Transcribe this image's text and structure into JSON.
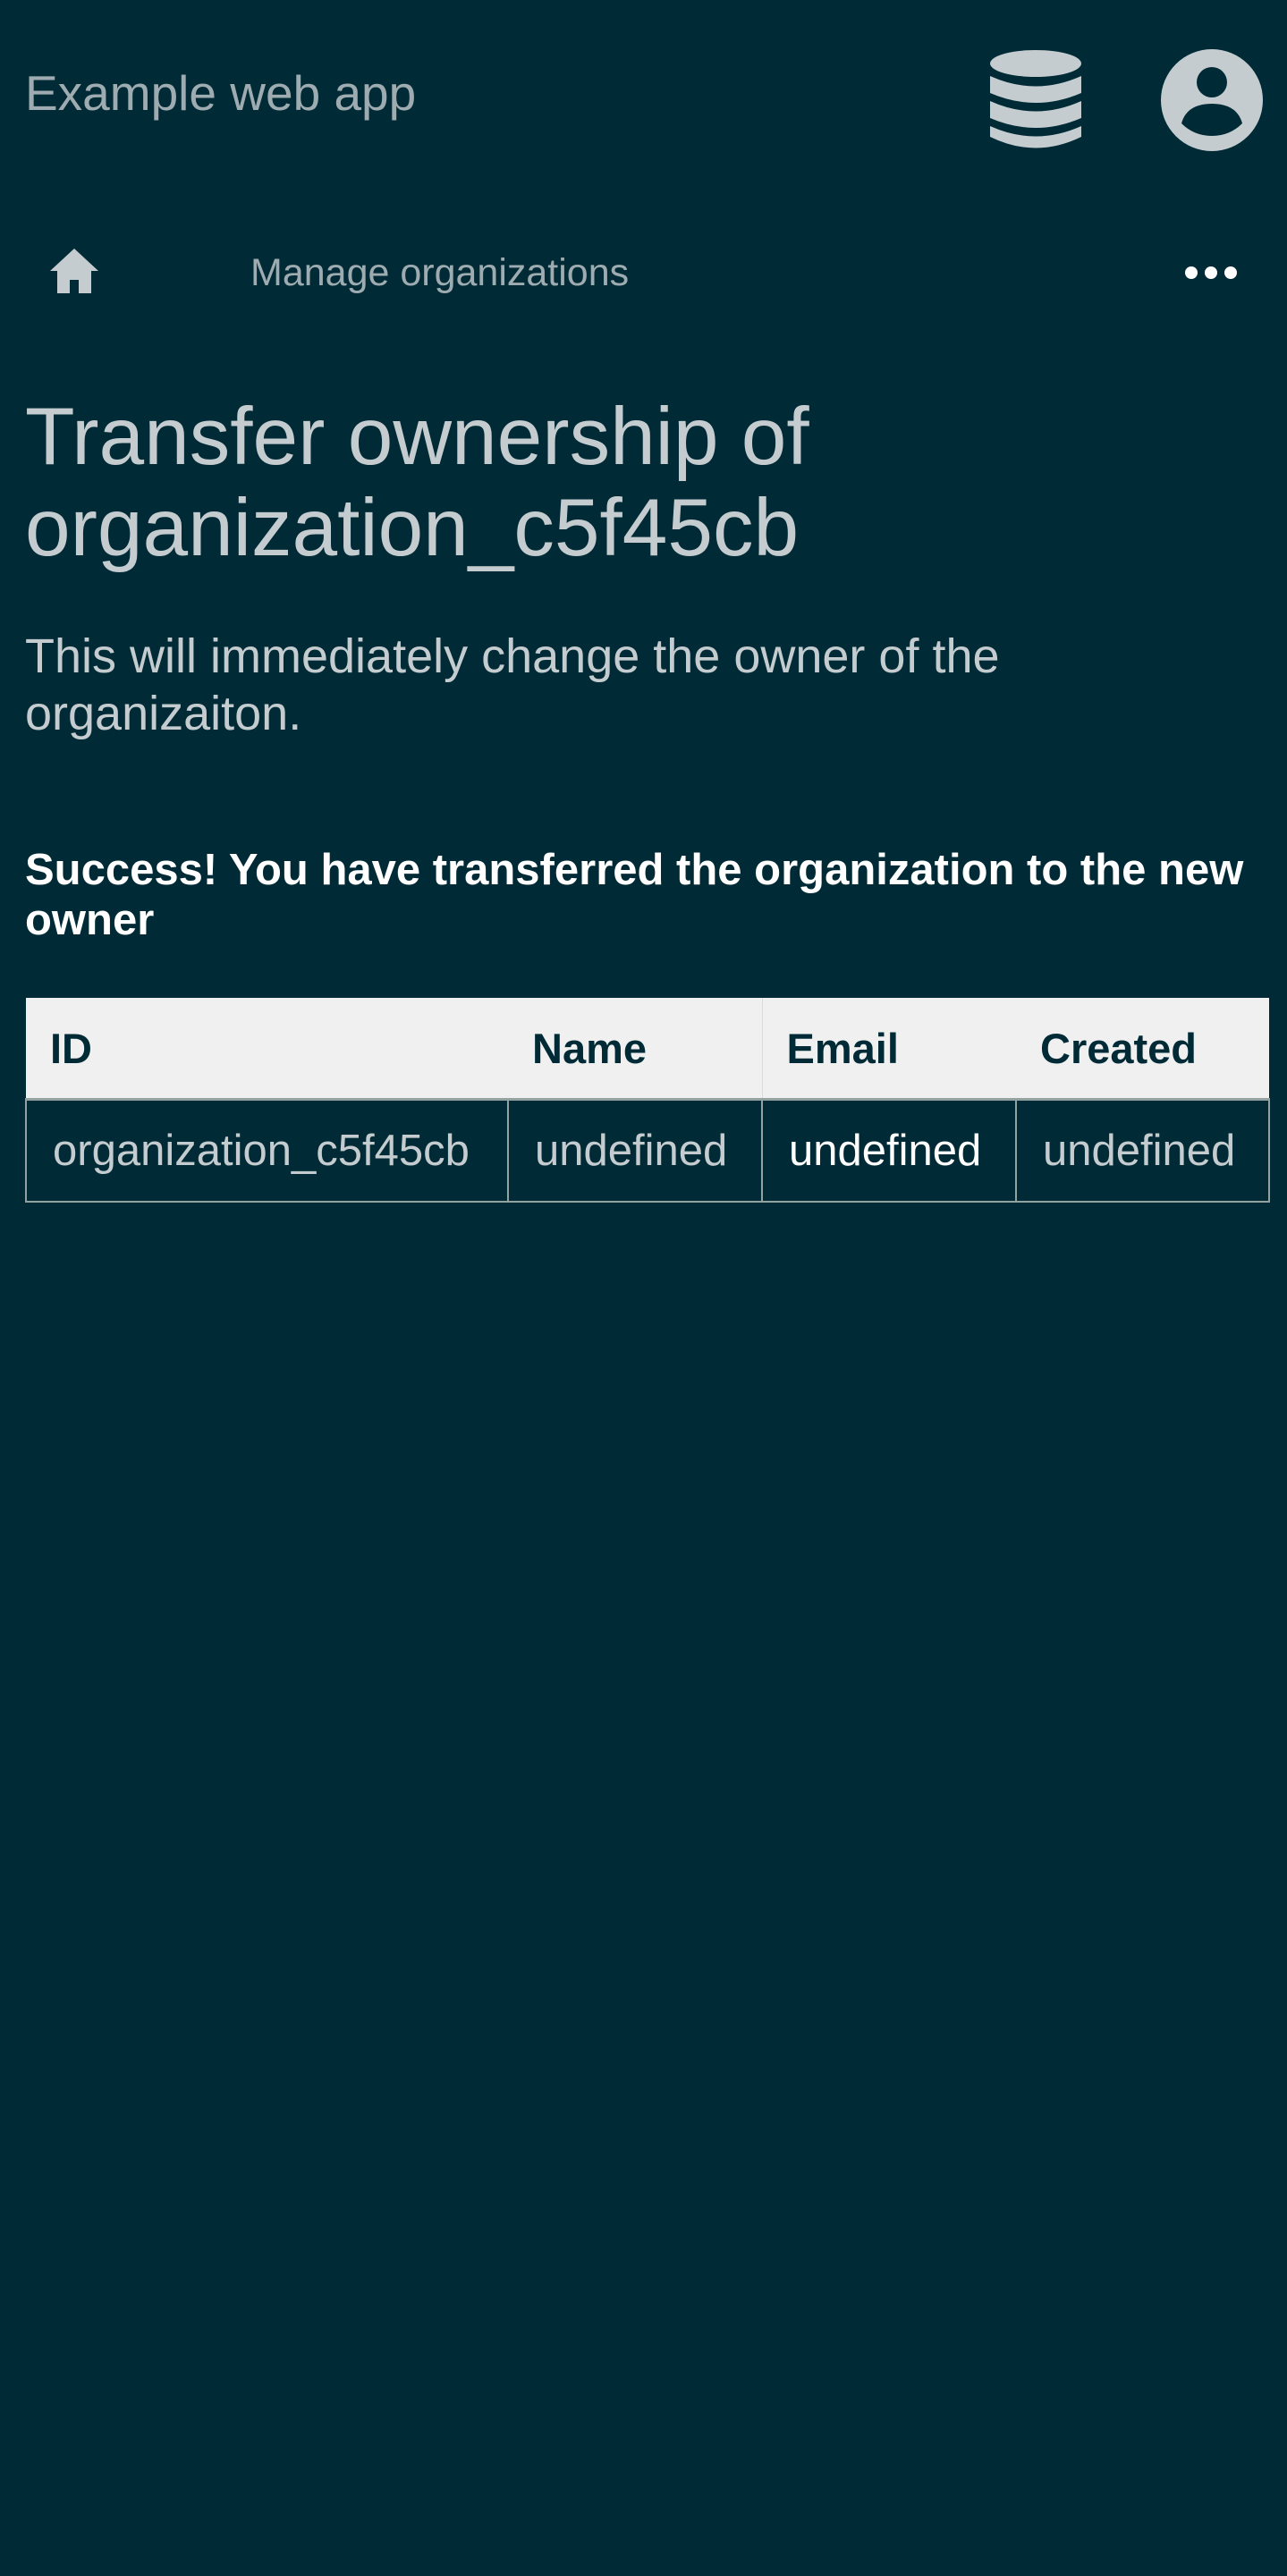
{
  "header": {
    "app_title": "Example web app",
    "data_icon": "database-icon",
    "account_icon": "account-circle-icon"
  },
  "nav": {
    "home_icon": "home-icon",
    "manage_link": "Manage organizations",
    "more_icon": "more-horizontal-icon"
  },
  "main": {
    "title": "Transfer ownership of organization_c5f45cb",
    "description": "This will immediately change the owner of the organizaiton.",
    "success_message": "Success! You have transferred the organization to the new owner"
  },
  "table": {
    "headers": [
      "ID",
      "Name",
      "Email",
      "Created"
    ],
    "rows": [
      [
        "organization_c5f45cb",
        "undefined",
        "undefined",
        "undefined"
      ]
    ]
  },
  "colors": {
    "background": "#002b36",
    "text": "#c5ccd0",
    "muted": "#9eacb1",
    "table_header_bg": "#f0f0f0",
    "table_header_text": "#002b36",
    "border": "#93a1a1"
  }
}
